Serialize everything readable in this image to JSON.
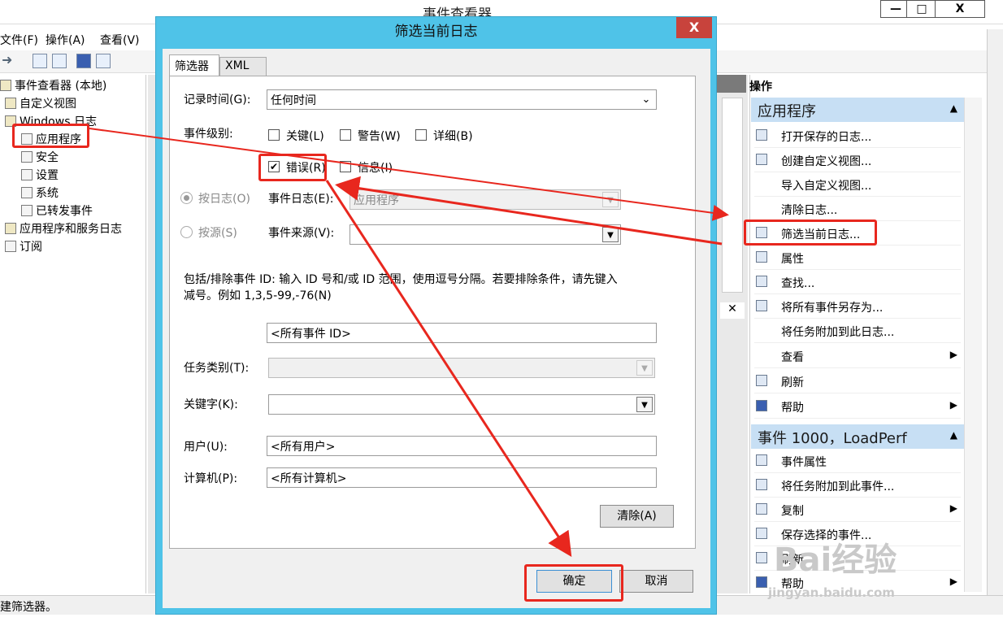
{
  "window": {
    "title": "事件查看器",
    "min": "—",
    "max": "□",
    "close": "X"
  },
  "menu": {
    "file": "文件(F)",
    "action": "操作(A)",
    "view": "查看(V)"
  },
  "tree": {
    "root": "事件查看器 (本地)",
    "custom_views": "自定义视图",
    "windows_logs": "Windows 日志",
    "application": "应用程序",
    "security": "安全",
    "setup": "设置",
    "system": "系统",
    "forwarded": "已转发事件",
    "app_service_logs": "应用程序和服务日志",
    "subscriptions": "订阅"
  },
  "actions": {
    "header": "操作",
    "section1": "应用程序",
    "section1_items": [
      "打开保存的日志...",
      "创建自定义视图...",
      "导入自定义视图...",
      "清除日志...",
      "筛选当前日志...",
      "属性",
      "查找...",
      "将所有事件另存为...",
      "将任务附加到此日志...",
      "查看",
      "刷新",
      "帮助"
    ],
    "section2": "事件 1000，LoadPerf",
    "section2_items": [
      "事件属性",
      "将任务附加到此事件...",
      "复制",
      "保存选择的事件...",
      "刷新",
      "帮助"
    ]
  },
  "status": "建筛选器。",
  "dialog": {
    "title": "筛选当前日志",
    "close": "X",
    "tab_filter": "筛选器",
    "tab_xml": "XML",
    "logged_label": "记录时间(G):",
    "logged_value": "任何时间",
    "level_label": "事件级别:",
    "critical": "关键(L)",
    "warning": "警告(W)",
    "verbose": "详细(B)",
    "error": "错误(R)",
    "info": "信息(I)",
    "by_log": "按日志(O)",
    "event_logs_label": "事件日志(E):",
    "event_logs_value": "应用程序",
    "by_source": "按源(S)",
    "source_label": "事件来源(V):",
    "id_desc_line1": "包括/排除事件 ID: 输入 ID 号和/或 ID 范围，使用逗号分隔。若要排除条件，请先键入",
    "id_desc_line2": "减号。例如 1,3,5-99,-76(N)",
    "id_value": "<所有事件 ID>",
    "task_label": "任务类别(T):",
    "keywords_label": "关键字(K):",
    "user_label": "用户(U):",
    "user_value": "<所有用户>",
    "computer_label": "计算机(P):",
    "computer_value": "<所有计算机>",
    "clear": "清除(A)",
    "ok": "确定",
    "cancel": "取消"
  },
  "watermark": {
    "brand": "Bai经验",
    "url": "jingyan.baidu.com"
  },
  "colors": {
    "highlight": "#e8271e",
    "dialog_frame": "#4fc3e8",
    "section_bar": "#c7dff4"
  }
}
